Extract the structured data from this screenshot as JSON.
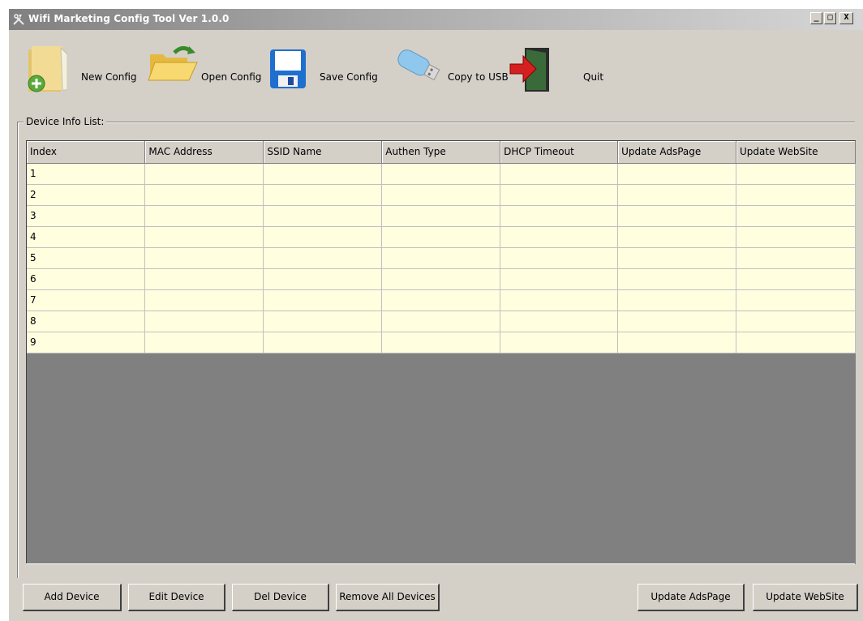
{
  "window": {
    "title": "Wifi Marketing Config Tool Ver 1.0.0",
    "controls": {
      "minimize": "_",
      "maximize": "□",
      "close": "X"
    }
  },
  "toolbar": {
    "items": [
      {
        "label": "New Config",
        "icon": "new-file-icon"
      },
      {
        "label": "Open Config",
        "icon": "open-folder-icon"
      },
      {
        "label": "Save Config",
        "icon": "floppy-disk-icon"
      },
      {
        "label": "Copy to USB",
        "icon": "usb-drive-icon"
      },
      {
        "label": "Quit",
        "icon": "exit-door-icon"
      }
    ]
  },
  "device_list": {
    "legend": "Device Info List:",
    "columns": [
      "Index",
      "MAC Address",
      "SSID Name",
      "Authen Type",
      "DHCP Timeout",
      "Update AdsPage",
      "Update WebSite"
    ],
    "rows": [
      [
        "1",
        "",
        "",
        "",
        "",
        "",
        ""
      ],
      [
        "2",
        "",
        "",
        "",
        "",
        "",
        ""
      ],
      [
        "3",
        "",
        "",
        "",
        "",
        "",
        ""
      ],
      [
        "4",
        "",
        "",
        "",
        "",
        "",
        ""
      ],
      [
        "5",
        "",
        "",
        "",
        "",
        "",
        ""
      ],
      [
        "6",
        "",
        "",
        "",
        "",
        "",
        ""
      ],
      [
        "7",
        "",
        "",
        "",
        "",
        "",
        ""
      ],
      [
        "8",
        "",
        "",
        "",
        "",
        "",
        ""
      ],
      [
        "9",
        "",
        "",
        "",
        "",
        "",
        ""
      ]
    ]
  },
  "buttons": {
    "add_device": "Add Device",
    "edit_device": "Edit Device",
    "del_device": "Del Device",
    "remove_all": "Remove All Devices",
    "update_adspage": "Update AdsPage",
    "update_website": "Update WebSite"
  },
  "colors": {
    "window_bg": "#d4d0c8",
    "row_bg": "#ffffe0",
    "grid_empty_bg": "#808080"
  }
}
